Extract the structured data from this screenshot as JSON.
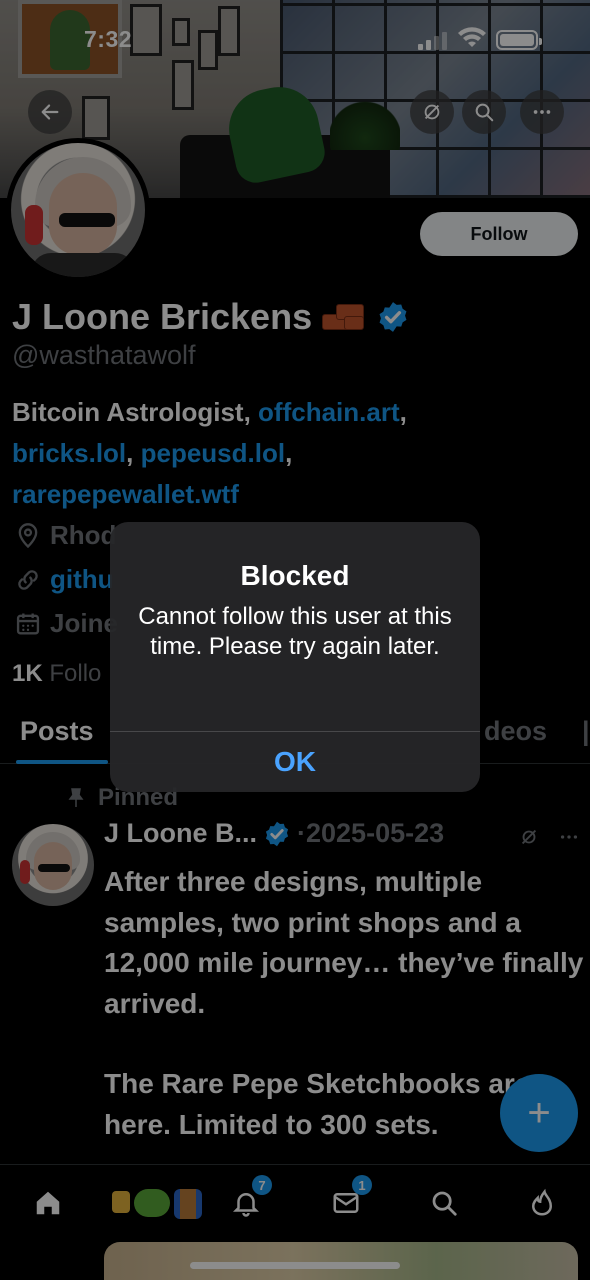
{
  "status_bar": {
    "time": "7:32"
  },
  "profile": {
    "name": "J Loone Brickens",
    "handle": "@wasthatawolf",
    "follow_label": "Follow",
    "bio_prefix": "Bitcoin Astrologist, ",
    "bio_links": [
      "offchain.art",
      "bricks.lol",
      "pepeusd.lol",
      "rarepepewallet.wtf"
    ],
    "location_partial": "Rhod",
    "website_partial": "githu",
    "joined_partial": "Joine",
    "followers_count": "1K",
    "followers_label_partial": "Follo"
  },
  "tabs": {
    "posts": "Posts",
    "videos_partial": "deos"
  },
  "post": {
    "pinned_label": "Pinned",
    "author": "J Loone B...",
    "date": "·2025-05-23",
    "paragraph1": "After three designs, multiple samples, two print shops and a 12,000 mile journey… they’ve finally arrived.",
    "paragraph2": "The Rare Pepe Sketchbooks are here. Limited to 300 sets."
  },
  "fab_label": "+",
  "bottom_nav": {
    "notifications_badge": "7",
    "messages_badge": "1"
  },
  "alert": {
    "title": "Blocked",
    "message": "Cannot follow this user at this time. Please try again later.",
    "button": "OK"
  },
  "colors": {
    "accent": "#1d9bf0",
    "alert_button": "#4aa3ff",
    "muted": "#71767b"
  }
}
